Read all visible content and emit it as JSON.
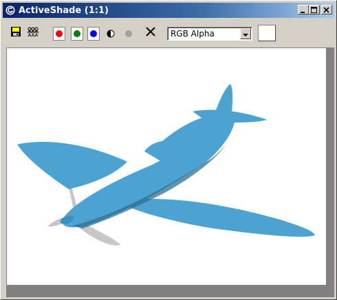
{
  "window": {
    "title": "ActiveShade (1:1)",
    "controls": {
      "minimize_icon": "minimize-icon",
      "maximize_icon": "maximize-icon",
      "close_icon": "close-icon"
    }
  },
  "toolbar": {
    "tools": [
      {
        "name": "save-image-icon"
      },
      {
        "name": "clone-window-icon"
      },
      {
        "name": "red-channel-toggle",
        "color": "#ff0000"
      },
      {
        "name": "green-channel-toggle",
        "color": "#008000"
      },
      {
        "name": "blue-channel-toggle",
        "color": "#0000ff"
      },
      {
        "name": "monochrome-icon"
      },
      {
        "name": "alpha-channel-icon"
      },
      {
        "name": "clear-icon"
      }
    ],
    "channel_display": {
      "selected": "RGB Alpha"
    },
    "swatch_color": "#ffffff"
  },
  "viewport": {
    "background": "#ffffff",
    "model_color": "#4ca3d2",
    "model_shadow_color": "#2e6f93",
    "propeller_color": "#b8b8b8"
  }
}
